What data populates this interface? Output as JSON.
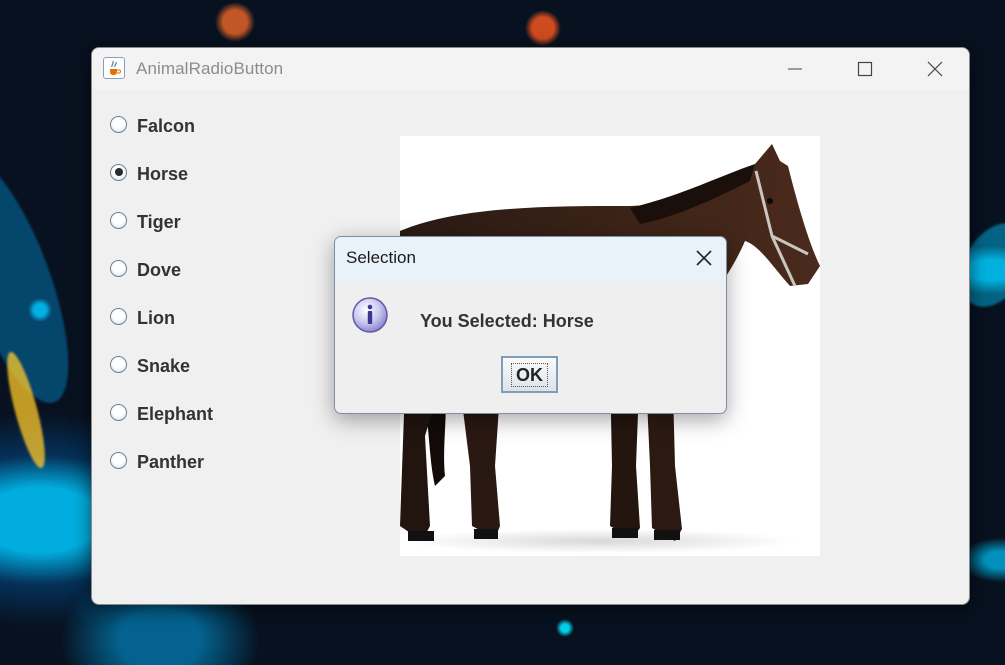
{
  "window": {
    "title": "AnimalRadioButton",
    "icon": "java-cup-icon"
  },
  "radio_options": [
    {
      "label": "Falcon",
      "selected": false
    },
    {
      "label": "Horse",
      "selected": true
    },
    {
      "label": "Tiger",
      "selected": false
    },
    {
      "label": "Dove",
      "selected": false
    },
    {
      "label": "Lion",
      "selected": false
    },
    {
      "label": "Snake",
      "selected": false
    },
    {
      "label": "Elephant",
      "selected": false
    },
    {
      "label": "Panther",
      "selected": false
    }
  ],
  "image": {
    "subject": "horse"
  },
  "dialog": {
    "title": "Selection",
    "message": "You Selected: Horse",
    "ok_label": "OK",
    "icon": "information-icon"
  }
}
